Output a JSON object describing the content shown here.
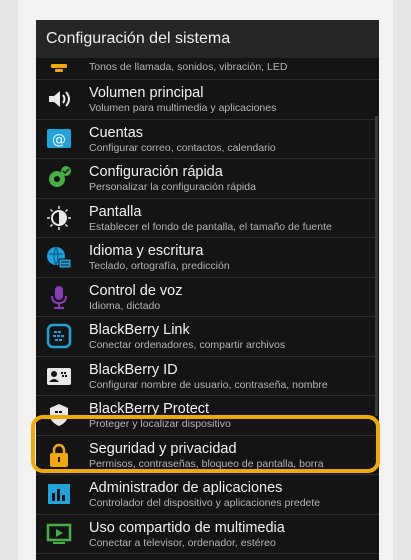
{
  "header": {
    "title": "Configuración del sistema"
  },
  "items": [
    {
      "title": "",
      "subtitle": "Tonos de llamada, sonidos, vibración, LED",
      "icon": "notifications-icon"
    },
    {
      "title": "Volumen principal",
      "subtitle": "Volumen para multimedia y aplicaciones",
      "icon": "speaker-icon"
    },
    {
      "title": "Cuentas",
      "subtitle": "Configurar correo, contactos, calendario",
      "icon": "at-sign-icon"
    },
    {
      "title": "Configuración rápida",
      "subtitle": "Personalizar la configuración rápida",
      "icon": "quick-settings-icon"
    },
    {
      "title": "Pantalla",
      "subtitle": "Establecer el fondo de pantalla, el tamaño de fuente",
      "icon": "display-icon"
    },
    {
      "title": "Idioma y escritura",
      "subtitle": "Teclado, ortografía, predicción",
      "icon": "language-icon"
    },
    {
      "title": "Control de voz",
      "subtitle": "Idioma, dictado",
      "icon": "microphone-icon"
    },
    {
      "title": "BlackBerry Link",
      "subtitle": "Conectar ordenadores, compartir archivos",
      "icon": "blackberry-link-icon"
    },
    {
      "title": "BlackBerry ID",
      "subtitle": "Configurar nombre de usuario, contraseña, nombre",
      "icon": "id-card-icon"
    },
    {
      "title": "BlackBerry Protect",
      "subtitle": "Proteger y localizar dispositivo",
      "icon": "protect-icon"
    },
    {
      "title": "Seguridad y privacidad",
      "subtitle": "Permisos, contraseñas, bloqueo de pantalla, borra",
      "icon": "lock-icon"
    },
    {
      "title": "Administrador de aplicaciones",
      "subtitle": "Controlador del dispositivo y aplicaciones predete",
      "icon": "app-manager-icon"
    },
    {
      "title": "Uso compartido de multimedia",
      "subtitle": "Conectar a televisor, ordenador, estéreo",
      "icon": "media-share-icon"
    }
  ],
  "colors": {
    "highlight": "#f0a80a",
    "background": "#141414"
  }
}
